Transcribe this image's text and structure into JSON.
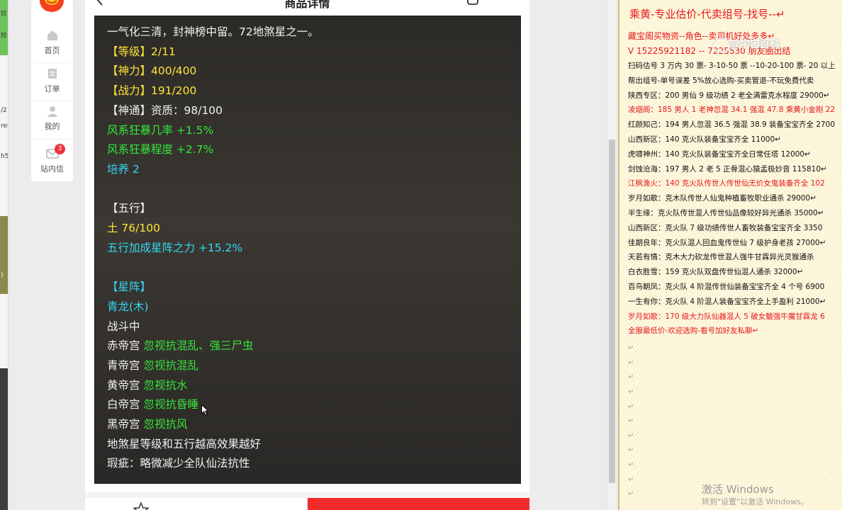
{
  "left_strip": {
    "glyphs": [
      "珍",
      "珍",
      "/2",
      "rel",
      "h5",
      ")"
    ]
  },
  "nav": {
    "items": [
      {
        "label": "首页",
        "icon": "home-icon"
      },
      {
        "label": "订单",
        "icon": "order-icon"
      },
      {
        "label": "我的",
        "icon": "user-icon"
      },
      {
        "label": "站内信",
        "icon": "message-icon",
        "badge": "3"
      }
    ]
  },
  "detail": {
    "title": "商品详情",
    "lines": [
      {
        "text": "一气化三清，封神榜中留。72地煞星之一。",
        "color": "white"
      },
      {
        "text": "【等级】2/11",
        "color": "yellow"
      },
      {
        "text": "【神力】400/400",
        "color": "yellow"
      },
      {
        "text": "【战力】191/200",
        "color": "yellow"
      },
      {
        "text": "【神通】资质：98/100",
        "color": "white"
      },
      {
        "text": "风系狂暴几率 +1.5%",
        "color": "green"
      },
      {
        "text": "风系狂暴程度 +2.7%",
        "color": "green"
      },
      {
        "text": "培养 2",
        "color": "cyan"
      },
      {
        "text": "",
        "color": "white"
      },
      {
        "text": "【五行】",
        "color": "white"
      },
      {
        "text": "土 76/100",
        "color": "yellow"
      },
      {
        "text": "五行加成星阵之力 +15.2%",
        "color": "cyan"
      },
      {
        "text": "",
        "color": "white"
      },
      {
        "text": "【星阵】",
        "color": "cyan"
      },
      {
        "text": "青龙(木)",
        "color": "cyan"
      },
      {
        "text": "战斗中",
        "color": "white"
      },
      {
        "parts": [
          {
            "text": "赤帝宫 ",
            "color": "white"
          },
          {
            "text": "忽视抗混乱、强三尸虫",
            "color": "green"
          }
        ]
      },
      {
        "parts": [
          {
            "text": "青帝宫 ",
            "color": "white"
          },
          {
            "text": "忽视抗混乱",
            "color": "green"
          }
        ]
      },
      {
        "parts": [
          {
            "text": "黄帝宫 ",
            "color": "white"
          },
          {
            "text": "忽视抗水",
            "color": "green"
          }
        ]
      },
      {
        "parts": [
          {
            "text": "白帝宫 ",
            "color": "white"
          },
          {
            "text": "忽视抗昏睡",
            "color": "green"
          }
        ]
      },
      {
        "parts": [
          {
            "text": "黑帝宫 ",
            "color": "white"
          },
          {
            "text": "忽视抗风",
            "color": "green"
          }
        ]
      },
      {
        "text": "地煞星等级和五行越高效果越好",
        "color": "white"
      },
      {
        "text": "瑕疵：略微减少全队仙法抗性",
        "color": "white"
      }
    ]
  },
  "doc": {
    "title": "乘黄-专业估价-代卖组号-找号--↵",
    "header_lines": [
      "藏宝阁买物资--角色--卖司机好处多多↵",
      "V 15225921182 -- 7225530 朋友圈出结"
    ],
    "lines": [
      {
        "text": "扫码估号 3 万内 30 票- 3-10-50 票  --10-20-100 票- 20 以上",
        "color": "black"
      },
      {
        "text": "帮出组号-单号误差 5%放心选购-买卖管退-不玩免费代卖",
        "color": "black"
      },
      {
        "text": "陕西专区：200 男仙 9 级功绩 2 老全满雷克水程度 29000↵",
        "color": "black"
      },
      {
        "text": "凌烟阁：185 男人 1 老神忽混 34.1 强混 47.8 乘黄小金刚 22",
        "color": "red"
      },
      {
        "text": "红颜知己：194 男人忽混 36.5 强混 38.9 装备宝宝齐全 2700",
        "color": "black"
      },
      {
        "text": "山西新区：140 克火队装备宝宝齐全 11000↵",
        "color": "black"
      },
      {
        "text": "虎啸神州：140 克火队装备宝宝齐全日常任塔 12000↵",
        "color": "black"
      },
      {
        "text": "剑蚀沧海：197 男人 2 老 5 正骨混心猿孟极妙音 115810↵",
        "color": "black"
      },
      {
        "text": "江枫渔火：140 克火队传世人传世仙无价女鬼装备齐全 102",
        "color": "red"
      },
      {
        "text": "岁月如歌：克木队传世人仙鬼种植畜牧职业通杀 29000↵",
        "color": "black"
      },
      {
        "text": "半生缘：克火队传世混人传世仙品像较好异光通杀 35000↵",
        "color": "black"
      },
      {
        "text": "山西新区：克火队 7 级功绩传世人畜牧装备宝宝齐全 3350",
        "color": "black"
      },
      {
        "text": "佳期良年：克火队混人回血鬼传世仙 7 级护身老孩 27000↵",
        "color": "black"
      },
      {
        "text": "天若有情：克木大力砍龙传世混人强牛甘霖异光灵猴通杀 ",
        "color": "black"
      },
      {
        "text": "白衣胜雪：159 克火队双盘传世仙混人通杀 32000↵",
        "color": "black"
      },
      {
        "text": "百鸟朝凤：克火队 4 阶混传世仙装备宝宝齐全 4 个号 6900",
        "color": "black"
      },
      {
        "text": "一生有你：克火队 4 阶混人装备宝宝齐全上手盈利 21000↵",
        "color": "black"
      },
      {
        "text": "岁月如歌：170 级大力队仙器混人 5 破女魃强牛魔甘霖龙 6",
        "color": "red"
      },
      {
        "text": "全服最低价-欢迎选购-看号加好友私聊↵",
        "color": "red"
      }
    ],
    "empty_mark": "↵"
  },
  "watermark": {
    "text": "@宇宙百科"
  },
  "windows": {
    "activate_title": "激活 Windows",
    "activate_sub": "转到\"设置\"以激活 Windows。"
  },
  "colors": {
    "white": "#f2f2f2",
    "yellow": "#ffe338",
    "green": "#35e63a",
    "cyan": "#33d6f2",
    "red": "#e8161c",
    "black": "#111111",
    "buy_button": "#f32a2a"
  }
}
